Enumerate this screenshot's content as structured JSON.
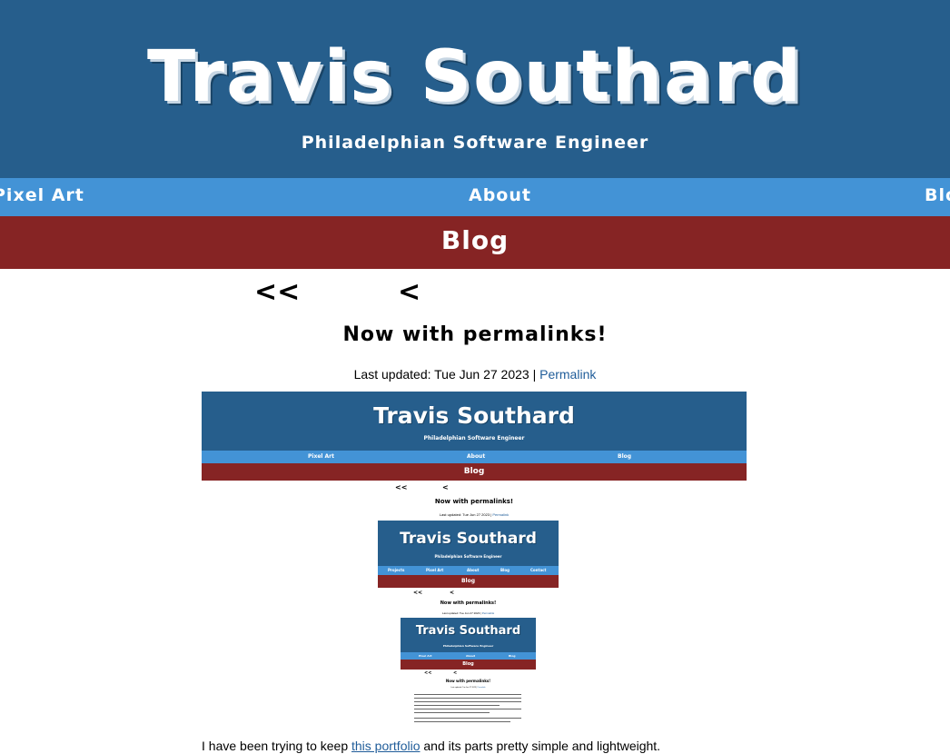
{
  "header": {
    "title": "Travis Southard",
    "subtitle": "Philadelphian Software Engineer"
  },
  "nav": {
    "items": [
      "Pixel Art",
      "About",
      "Blog"
    ]
  },
  "page_banner": "Blog",
  "pager": {
    "first": "<<",
    "prev": "<"
  },
  "post": {
    "title": "Now with permalinks!",
    "meta_prefix": "Last updated: Tue Jun 27 2023 | ",
    "permalink": "Permalink",
    "body_start": "I have been trying to keep ",
    "body_link": "this portfolio",
    "body_end": " and its parts pretty simple and lightweight."
  },
  "screenshot": {
    "title": "Travis Southard",
    "subtitle": "Philadelphian Software Engineer",
    "nav_items": [
      "Pixel Art",
      "About",
      "Blog"
    ],
    "banner": "Blog",
    "pager_first": "<<",
    "pager_prev": "<",
    "post_title": "Now with permalinks!",
    "meta_prefix": "Last updated: Tue Jun 27 2023 | ",
    "permalink": "Permalink",
    "inner": {
      "title": "Travis Southard",
      "subtitle": "Philadelphian Software Engineer",
      "nav_items": [
        "Projects",
        "Pixel Art",
        "About",
        "Blog",
        "Contact"
      ],
      "banner": "Blog",
      "pager_first": "<<",
      "pager_prev": "<",
      "post_title": "Now with permalinks!",
      "meta_prefix": "Last updated: Tue Jun 27 2023 | ",
      "permalink": "Permalink",
      "innermost": {
        "title": "Travis Southard",
        "subtitle": "Philadelphian Software Engineer",
        "nav_items": [
          "Pixel Art",
          "About",
          "Blog"
        ],
        "banner": "Blog",
        "pager_first": "<<",
        "pager_prev": "<",
        "post_title": "Now with permalinks!",
        "meta_prefix": "Last updated: Tue Jun 27 2023 | ",
        "permalink": "Permalink"
      }
    }
  },
  "colors": {
    "header_bg": "#265e8c",
    "nav_bg": "#4393d6",
    "banner_bg": "#862424",
    "link": "#1f5c99"
  }
}
